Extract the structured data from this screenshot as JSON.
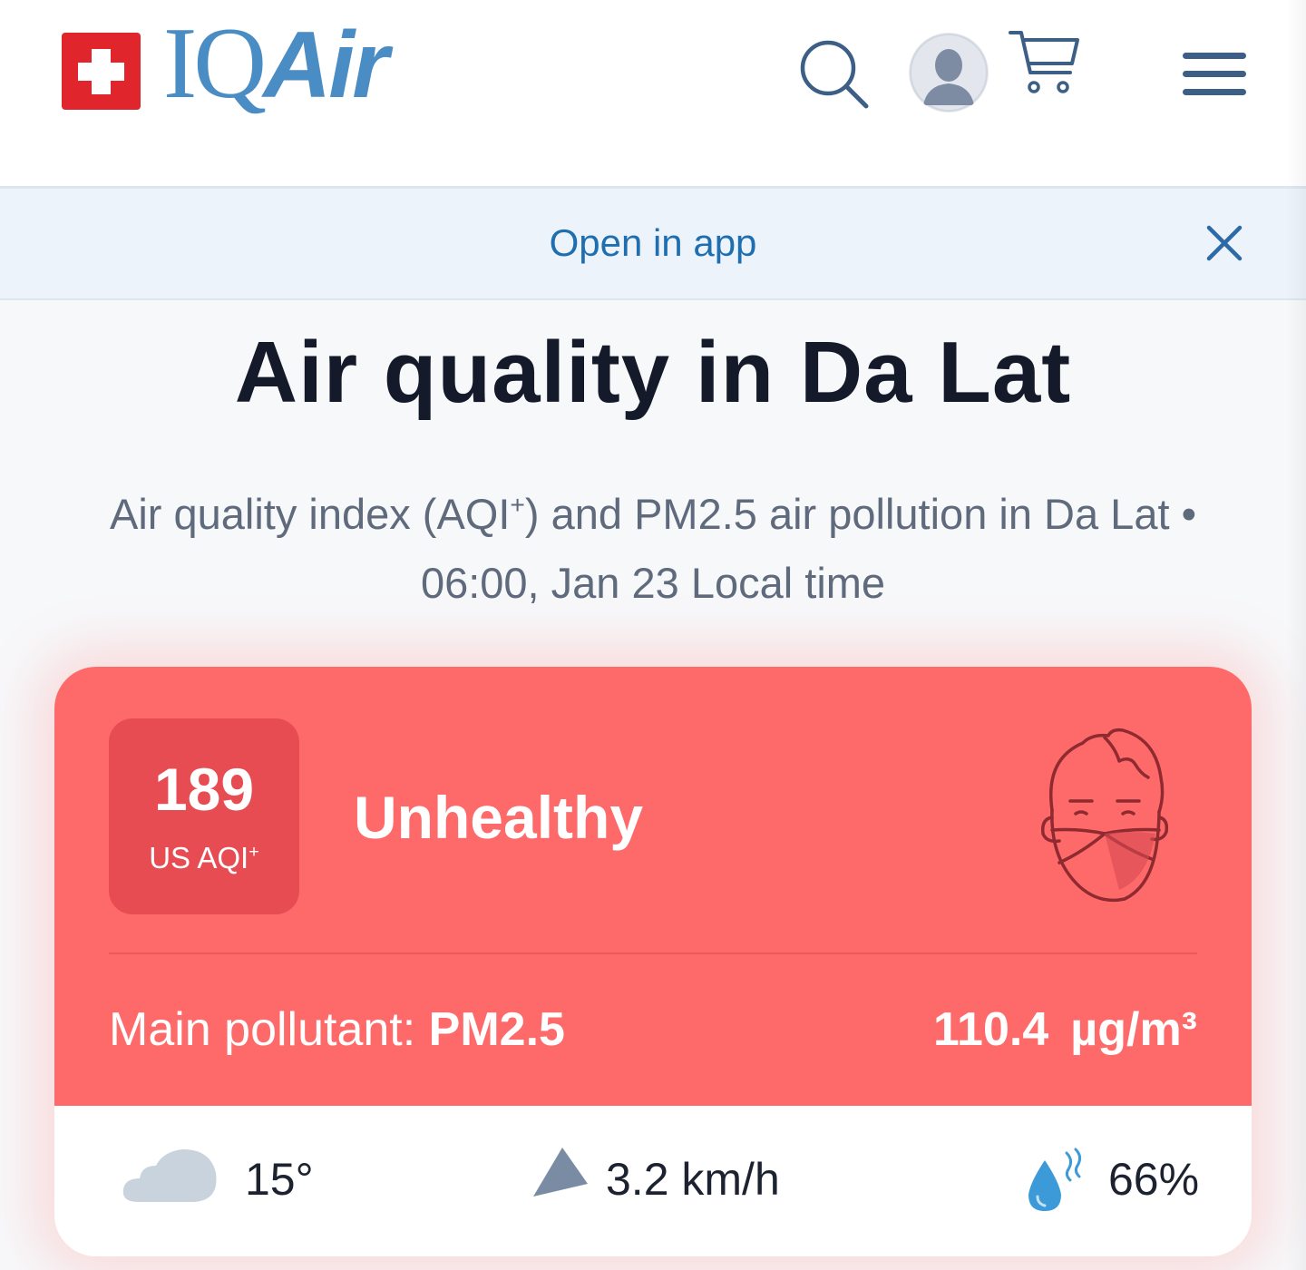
{
  "header": {
    "brand": "IQ",
    "brand_italic": "Air"
  },
  "banner": {
    "open_in_app": "Open in app"
  },
  "page": {
    "title": "Air quality in Da Lat",
    "subtitle_line1": "Air quality index (AQI",
    "subtitle_sup": "+",
    "subtitle_line1_rest": ") and PM2.5 air pollution in Da Lat •",
    "subtitle_line2": "06:00, Jan 23 Local time"
  },
  "aqi": {
    "value": "189",
    "unit": "US AQI",
    "unit_sup": "+",
    "status": "Unhealthy",
    "main_pollutant_label": "Main pollutant: ",
    "main_pollutant": "PM2.5",
    "concentration_value": "110.4",
    "concentration_unit": "µg/m³",
    "status_color": "#fe6a6a"
  },
  "weather": {
    "temperature": "15°",
    "wind_speed": "3.2 km/h",
    "humidity": "66%"
  },
  "icons": {
    "search": "search-icon",
    "avatar": "user-avatar",
    "cart": "cart-icon",
    "menu": "hamburger-menu-icon",
    "close": "close-icon",
    "face": "face-mask-icon",
    "cloud": "cloud-icon",
    "wind": "wind-direction-icon",
    "humidity": "humidity-icon"
  }
}
